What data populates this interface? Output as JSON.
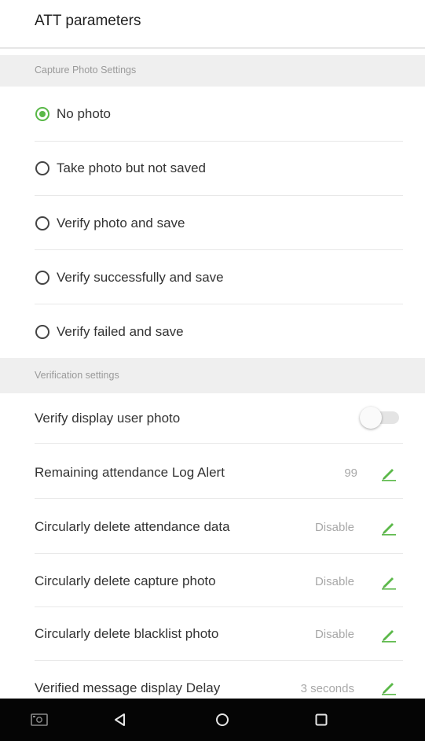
{
  "header": {
    "title": "ATT parameters"
  },
  "capture_section": {
    "title": "Capture Photo Settings"
  },
  "capture_options": [
    {
      "label": "No photo",
      "selected": true
    },
    {
      "label": "Take photo but not saved",
      "selected": false
    },
    {
      "label": "Verify photo and save",
      "selected": false
    },
    {
      "label": "Verify successfully and save",
      "selected": false
    },
    {
      "label": "Verify failed and save",
      "selected": false
    }
  ],
  "verification_section": {
    "title": "Verification settings"
  },
  "verify_display_user_photo": {
    "label": "Verify display user photo",
    "enabled": false
  },
  "settings": [
    {
      "label": "Remaining attendance Log Alert",
      "value": "99"
    },
    {
      "label": "Circularly delete attendance data",
      "value": "Disable"
    },
    {
      "label": "Circularly delete capture photo",
      "value": "Disable"
    },
    {
      "label": "Circularly delete blacklist photo",
      "value": "Disable"
    },
    {
      "label": "Verified message display Delay",
      "value": "3 seconds"
    }
  ],
  "colors": {
    "accent": "#59b848",
    "section_bg": "#efefef",
    "navbar_bg": "#050505"
  },
  "icons": {
    "edit": "pencil-icon",
    "nav": [
      "screenshot-icon",
      "back-icon",
      "home-icon",
      "recents-icon"
    ]
  }
}
